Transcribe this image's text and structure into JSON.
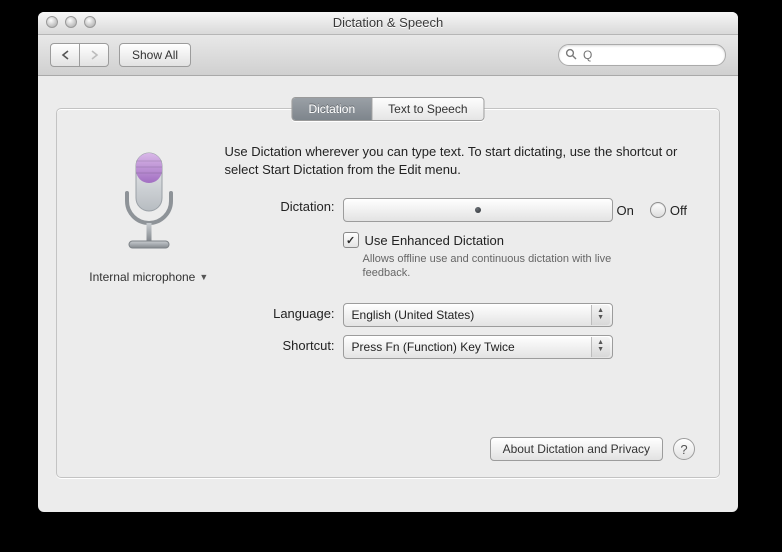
{
  "window": {
    "title": "Dictation & Speech"
  },
  "toolbar": {
    "show_all": "Show All",
    "search_placeholder": "Q"
  },
  "tabs": {
    "dictation": "Dictation",
    "tts": "Text to Speech"
  },
  "left": {
    "mic_label": "Internal microphone"
  },
  "main": {
    "description": "Use Dictation wherever you can type text. To start dictating, use the shortcut or select Start Dictation from the Edit menu.",
    "dictation_label": "Dictation:",
    "on": "On",
    "off": "Off",
    "enhanced_label": "Use Enhanced Dictation",
    "enhanced_hint": "Allows offline use and continuous dictation with live feedback.",
    "language_label": "Language:",
    "language_value": "English (United States)",
    "shortcut_label": "Shortcut:",
    "shortcut_value": "Press Fn (Function) Key Twice"
  },
  "footer": {
    "about": "About Dictation and Privacy",
    "help": "?"
  }
}
